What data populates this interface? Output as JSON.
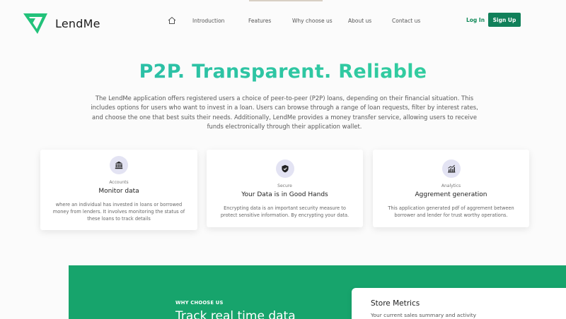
{
  "header": {
    "brand": "LendMe",
    "nav": [
      {
        "label": "Introduction"
      },
      {
        "label": "Features"
      },
      {
        "label": "Why choose us"
      },
      {
        "label": "About us"
      },
      {
        "label": "Contact us"
      }
    ],
    "login_label": "Log In",
    "signup_label": "Sign Up"
  },
  "hero": {
    "title": "P2P. Transparent. Reliable",
    "description": "The LendMe application offers registered users a choice of peer-to-peer (P2P) loans, depending on their financial situation. This includes options for users who want to invest in a loan. Users can browse through a range of loan requests, filter by interest rates, and choose the one that best suits their needs. Additionally, LendMe provides a money transfer service, allowing users to receive funds electronically through their application wallet."
  },
  "features": [
    {
      "icon": "bank-icon",
      "tag": "Accounts",
      "title": "Monitor data",
      "description": "where an individual has invested in loans or borrowed money from lenders. It involves monitoring the status of these loans to track details"
    },
    {
      "icon": "shield-icon",
      "tag": "Secure",
      "title": "Your Data is in Good Hands",
      "description": "Encrypting data is an important security measure to protect sensitive information. By encrypting your data."
    },
    {
      "icon": "chart-icon",
      "tag": "Analytics",
      "title": "Aggrement generation",
      "description": "This application generated pdf of aggrement between borrower and lender for trust worthy operations."
    }
  ],
  "why": {
    "label": "WHY CHOOSE US",
    "title": "Track real time data"
  },
  "metrics": {
    "title": "Store Metrics",
    "subtitle": "Your current sales summary and activity"
  },
  "colors": {
    "brand_green": "#17a46c",
    "button_green": "#11805a",
    "title_gradient_start": "#28b9a9",
    "title_gradient_end": "#35d39c",
    "icon_bg": "#e3e3f3"
  }
}
